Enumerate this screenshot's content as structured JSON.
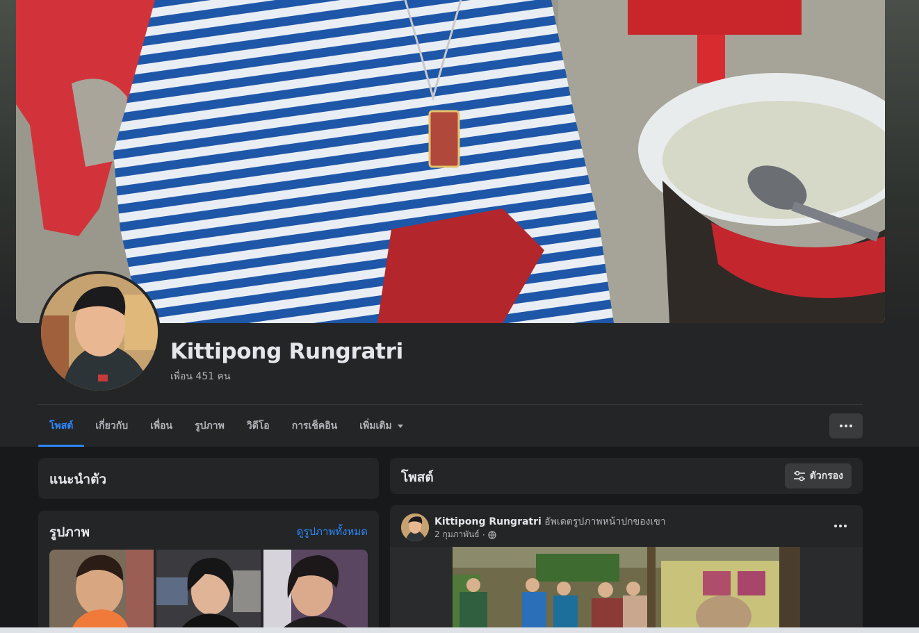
{
  "profile": {
    "name": "Kittipong Rungratri",
    "friends": "เพื่อน 451 คน"
  },
  "tabs": [
    {
      "label": "โพสต์",
      "active": true
    },
    {
      "label": "เกี่ยวกับ"
    },
    {
      "label": "เพื่อน"
    },
    {
      "label": "รูปภาพ"
    },
    {
      "label": "วิดีโอ"
    },
    {
      "label": "การเช็คอิน"
    },
    {
      "label": "เพิ่มเติม"
    }
  ],
  "intro": {
    "title": "แนะนำตัว"
  },
  "photos": {
    "title": "รูปภาพ",
    "see_all": "ดูรูปภาพทั้งหมด"
  },
  "posts": {
    "title": "โพสต์",
    "filter_label": "ตัวกรอง"
  },
  "post": {
    "author": "Kittipong Rungratri",
    "action": "อัพเดตรูปภาพหน้าปกของเขา",
    "date": "2 กุมภาพันธ์",
    "separator": "·"
  },
  "colors": {
    "accent": "#2d88ff",
    "card": "#242526",
    "background": "#18191a"
  }
}
